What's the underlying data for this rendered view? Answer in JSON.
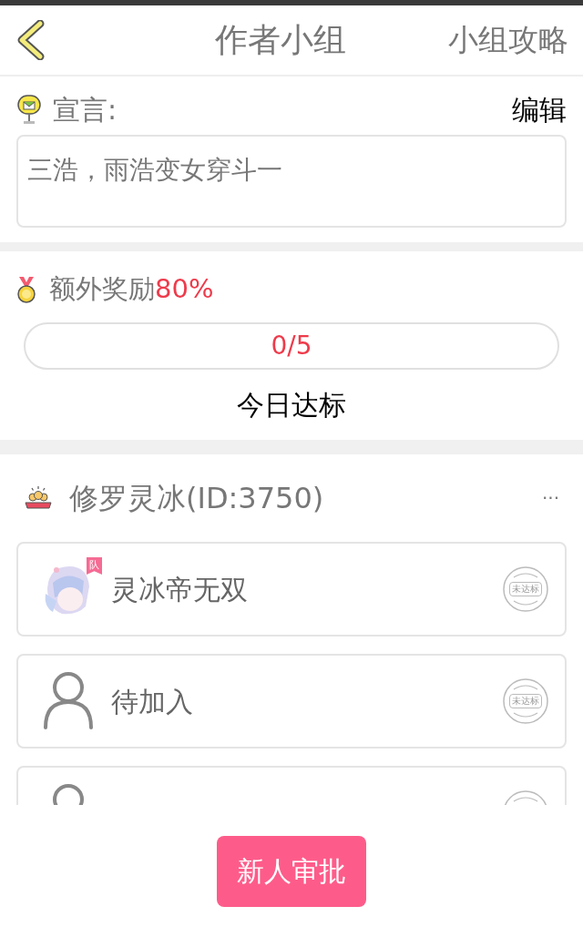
{
  "header": {
    "title": "作者小组",
    "action": "小组攻略"
  },
  "declaration": {
    "label": "宣言:",
    "edit": "编辑",
    "text": "三浩，雨浩变女穿斗一"
  },
  "bonus": {
    "label": "额外奖励",
    "percent": "80%",
    "progress": {
      "level": 0,
      "reading": "0/5"
    },
    "caption": "今日达标"
  },
  "team": {
    "name": "修罗灵冰(ID:3750)",
    "more": "···",
    "members": [
      {
        "kind": "member",
        "name": "灵冰帝无双",
        "badge": "队",
        "status": "未达标"
      },
      {
        "kind": "vacant",
        "name": "待加入",
        "status": "未达标"
      },
      {
        "kind": "vacant"
      }
    ]
  },
  "approve_button": "新人审批"
}
